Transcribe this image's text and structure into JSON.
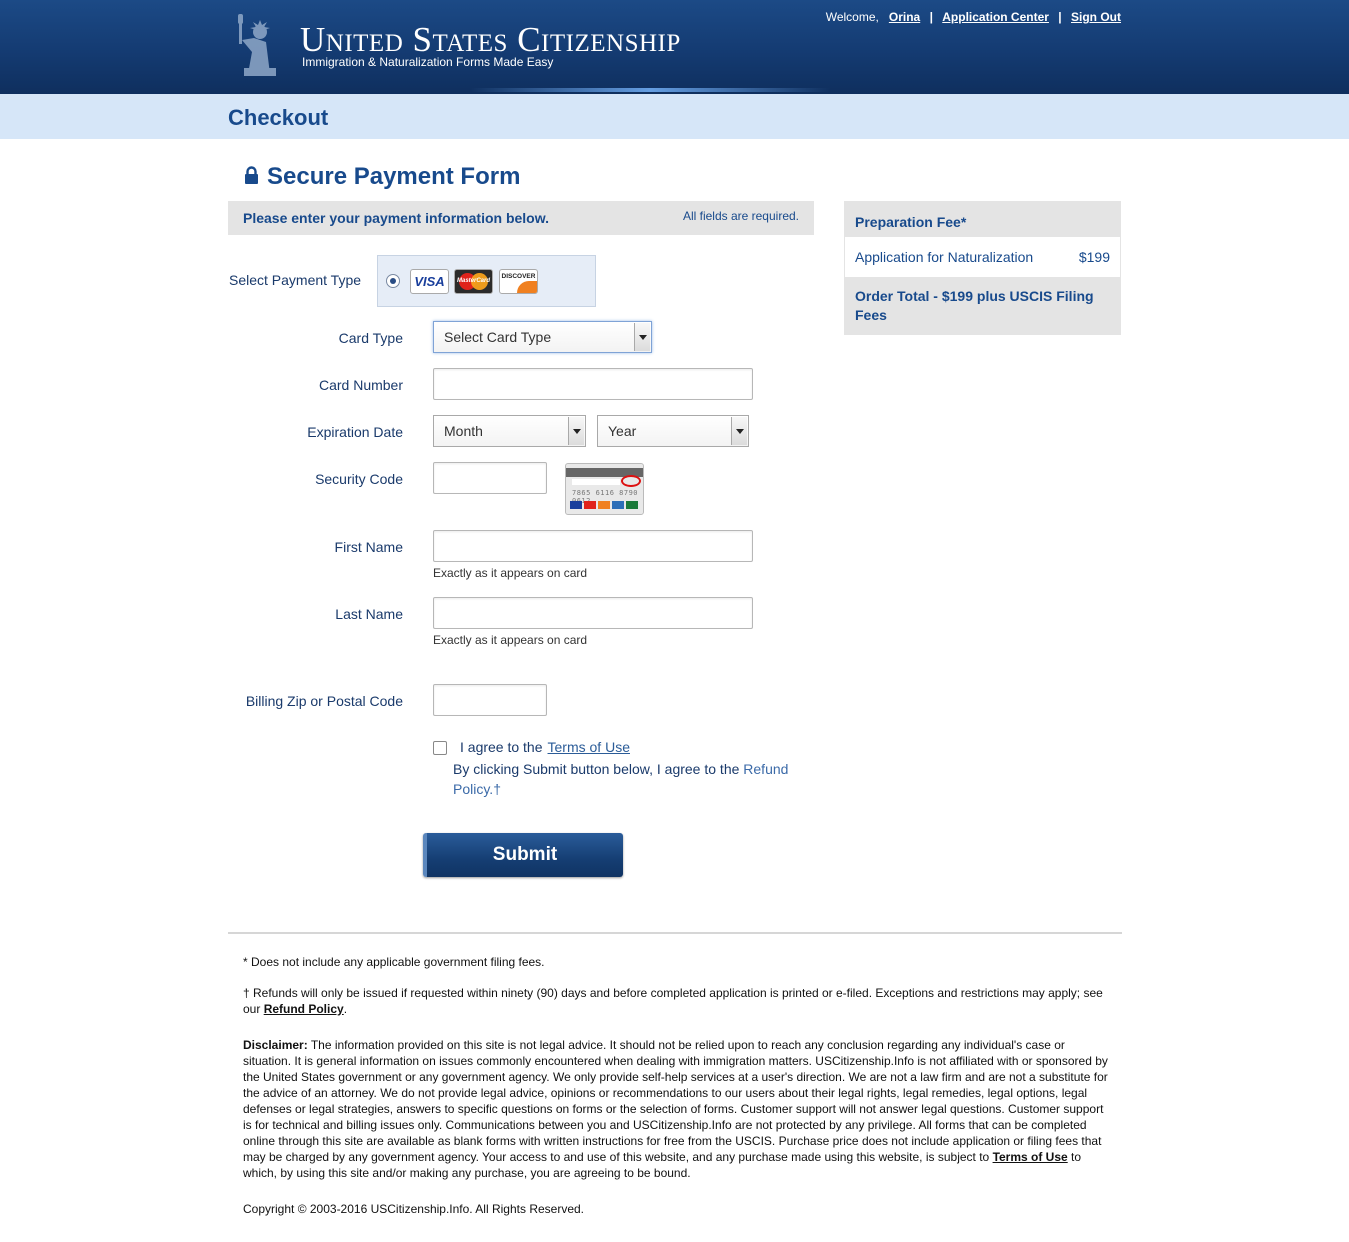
{
  "header": {
    "logo_title": "United States Citizenship",
    "logo_tagline": "Immigration & Naturalization Forms Made Easy",
    "welcome": "Welcome,",
    "user_name": "Orina",
    "app_center": "Application Center",
    "sign_out": "Sign Out",
    "sep": "|"
  },
  "page_title": "Checkout",
  "form": {
    "title": "Secure Payment Form",
    "info": "Please enter your payment information below.",
    "required_note": "All fields are required.",
    "payment_type_label": "Select Payment Type",
    "card_logos": {
      "visa": "VISA",
      "mastercard": "MasterCard",
      "discover": "DISCOVER"
    },
    "card_type_label": "Card Type",
    "card_type_value": "Select Card Type",
    "card_number_label": "Card Number",
    "card_number_value": "",
    "expiration_label": "Expiration Date",
    "month_value": "Month",
    "year_value": "Year",
    "security_code_label": "Security Code",
    "security_code_value": "",
    "first_name_label": "First Name",
    "first_name_value": "",
    "last_name_label": "Last Name",
    "last_name_value": "",
    "name_hint": "Exactly as it appears on card",
    "zip_label": "Billing Zip or Postal Code",
    "zip_value": "",
    "agree_text": "I agree to the",
    "terms_link": "Terms of Use",
    "refund_text": "By clicking Submit button below, I agree to the",
    "refund_link": "Refund Policy.†",
    "submit_label": "Submit",
    "cvv_sample_number": "7865 6116 8790 0612"
  },
  "fee": {
    "header": "Preparation Fee*",
    "item": "Application for Naturalization",
    "price": "$199",
    "total": "Order Total - $199 plus USCIS Filing Fees"
  },
  "footer": {
    "note1": "* Does not include any applicable government filing fees.",
    "note2_a": "† Refunds will only be issued if requested within ninety (90) days and before completed application is printed or e-filed. Exceptions and restrictions may apply; see our",
    "note2_link": "Refund Policy",
    "note2_end": ".",
    "disclaimer_label": "Disclaimer:",
    "disclaimer_text": "The information provided on this site is not legal advice. It should not be relied upon to reach any conclusion regarding any individual's case or situation. It is general information on issues commonly encountered when dealing with immigration matters. USCitizenship.Info is not affiliated with or sponsored by the United States government or any government agency. We only provide self-help services at a user's direction. We are not a law firm and are not a substitute for the advice of an attorney. We do not provide legal advice, opinions or recommendations to our users about their legal rights, legal remedies, legal options, legal defenses or legal strategies, answers to specific questions on forms or the selection of forms. Customer support will not answer legal questions. Customer support is for technical and billing issues only. Communications between you and USCitizenship.Info are not protected by any privilege. All forms that can be completed online through this site are available as blank forms with written instructions for free from the USCIS. Purchase price does not include application or filing fees that may be charged by any government agency. Your access to and use of this website, and any purchase made using this website, is subject to",
    "disclaimer_link": "Terms of Use",
    "disclaimer_end": "to which, by using this site and/or making any purchase, you are agreeing to be bound.",
    "copyright": "Copyright © 2003-2016 USCitizenship.Info. All Rights Reserved."
  }
}
